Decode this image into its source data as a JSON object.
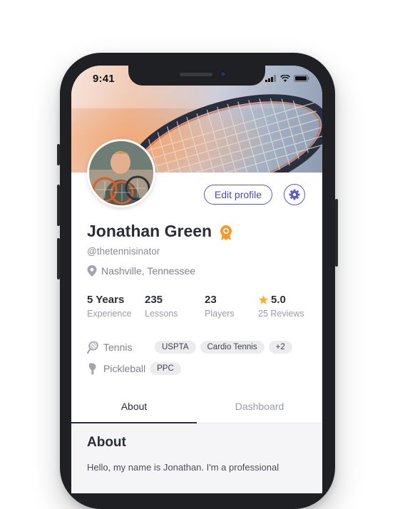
{
  "status_bar": {
    "time": "9:41"
  },
  "profile": {
    "name": "Jonathan Green",
    "handle": "@thetennisinator",
    "location": "Nashville, Tennessee",
    "edit_button": "Edit profile"
  },
  "stats": [
    {
      "value": "5 Years",
      "label": "Experience"
    },
    {
      "value": "235",
      "label": "Lessons"
    },
    {
      "value": "23",
      "label": "Players"
    },
    {
      "value": "5.0",
      "label": "25 Reviews"
    }
  ],
  "sports": [
    {
      "name": "Tennis",
      "tags": [
        "USPTA",
        "Cardio Tennis",
        "+2"
      ]
    },
    {
      "name": "Pickleball",
      "tags": [
        "PPC"
      ]
    }
  ],
  "tabs": [
    {
      "label": "About",
      "active": true
    },
    {
      "label": "Dashboard",
      "active": false
    }
  ],
  "about": {
    "heading": "About",
    "text": "Hello, my name is Jonathan. I'm a professional"
  },
  "colors": {
    "accent": "#5b58c9",
    "badge": "#f29a2e",
    "star": "#f2b431"
  },
  "icons": [
    "signal-icon",
    "wifi-icon",
    "battery-icon",
    "gear-icon",
    "award-badge-icon",
    "location-pin-icon",
    "star-icon",
    "tennis-racket-icon",
    "pickleball-paddle-icon"
  ]
}
